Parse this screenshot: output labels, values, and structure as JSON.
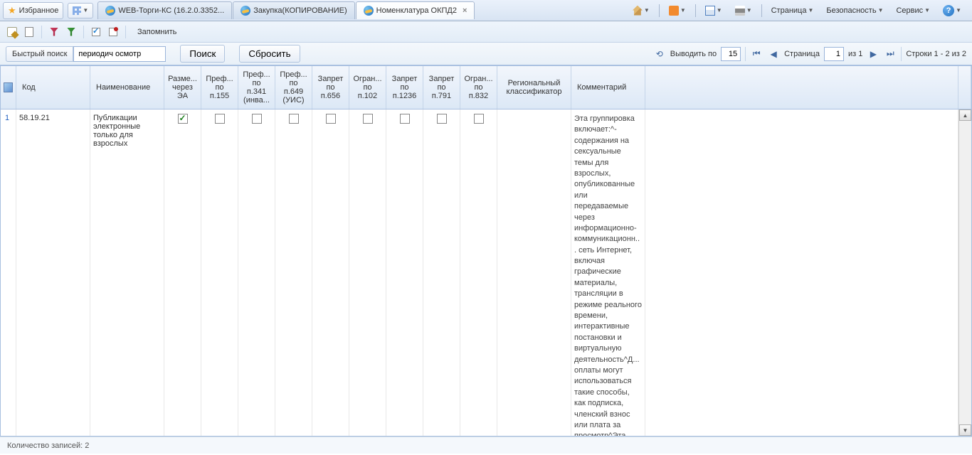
{
  "browser": {
    "favorites": "Избранное",
    "tabs": [
      {
        "label": "WEB-Торги-КС (16.2.0.3352...",
        "active": false
      },
      {
        "label": "Закупка(КОПИРОВАНИЕ)",
        "active": false
      },
      {
        "label": "Номенклатура ОКПД2",
        "active": true
      }
    ],
    "menu": {
      "page": "Страница",
      "security": "Безопасность",
      "service": "Сервис"
    }
  },
  "toolbar": {
    "remember": "Запомнить"
  },
  "search": {
    "quick_label": "Быстрый поиск",
    "value": "периодич осмотр",
    "search_btn": "Поиск",
    "reset_btn": "Сбросить"
  },
  "pager": {
    "show_by": "Выводить по",
    "page_size": "15",
    "page_label": "Страница",
    "page_num": "1",
    "of_label": "из 1",
    "rows_label": "Строки 1 - 2 из 2"
  },
  "grid": {
    "headers": {
      "code": "Код",
      "name": "Наименование",
      "ea": "Разме...\nчерез\nЭА",
      "p155": "Преф...\nпо\nп.155",
      "p341": "Преф...\nпо\nп.341\n(инва...",
      "p649": "Преф...\nпо\nп.649\n(УИС)",
      "p656": "Запрет\nпо\nп.656",
      "p102": "Огран...\nпо\nп.102",
      "p1236": "Запрет\nпо\nп.1236",
      "p791": "Запрет\nпо\nп.791",
      "p832": "Огран...\nпо\nп.832",
      "regional": "Региональный\nклассификатор",
      "comment": "Комментарий"
    },
    "rows": [
      {
        "idx": "1",
        "code": "58.19.21",
        "name": "Публикации электронные только для взрослых",
        "ea": true,
        "p155": false,
        "p341": false,
        "p649": false,
        "p656": false,
        "p102": false,
        "p1236": false,
        "p791": false,
        "p832": false,
        "regional": "",
        "comment": "Эта группировка включает:^- содержания на сексуальные темы для взрослых, опубликованные или передаваемые через информационно-коммуникационн... сеть Интернет, включая графические материалы, трансляции в режиме реального времени, интерактивные постановки и виртуальную деятельность^Д... оплаты могут использоваться такие способы, как подписка, членский взнос или плата за просмотр^Эта группировка не"
      }
    ]
  },
  "status": {
    "count": "Количество записей: 2"
  }
}
